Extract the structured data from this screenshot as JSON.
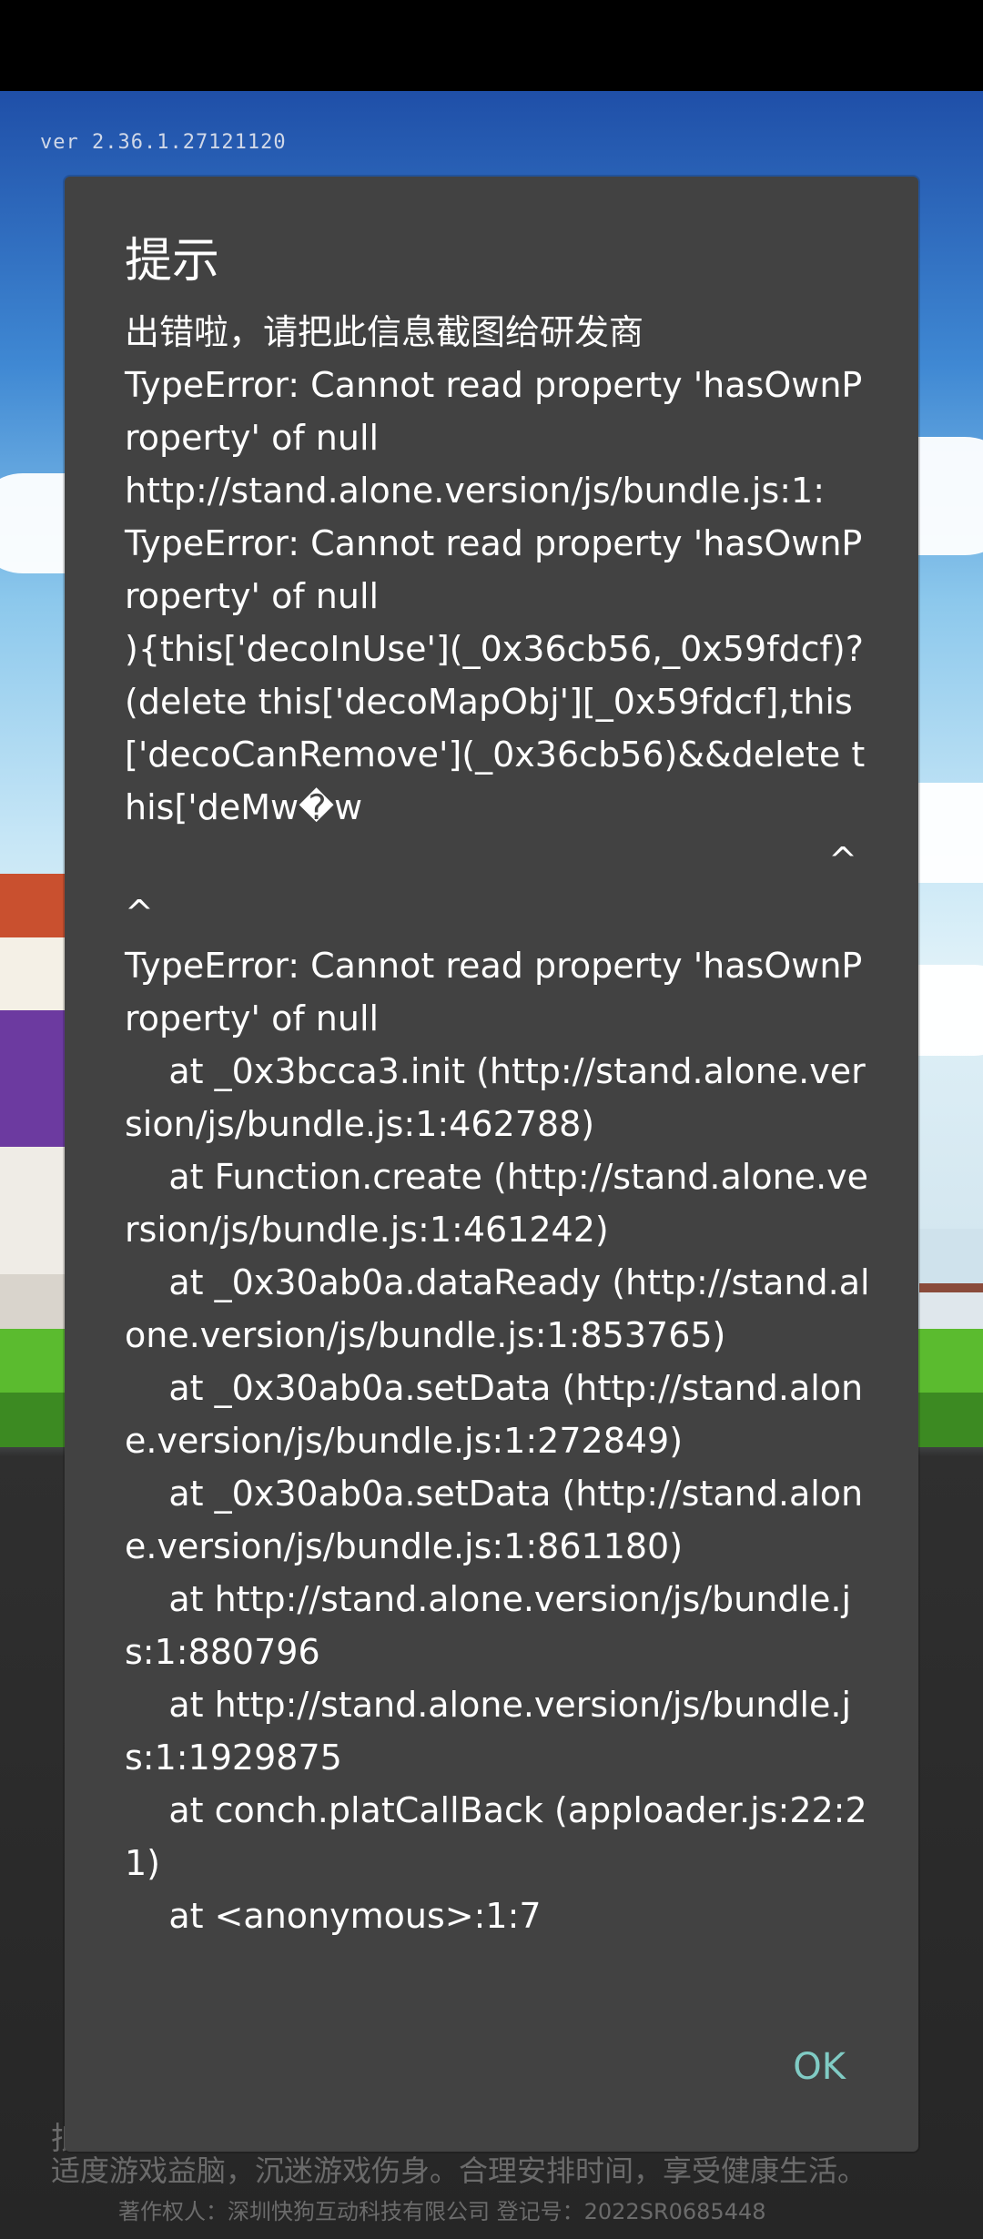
{
  "version": "ver 2.36.1.27121120",
  "dialog": {
    "title": "提示",
    "message": "出错啦，请把此信息截图给研发商\nTypeError: Cannot read property 'hasOwnProperty' of null\nhttp://stand.alone.version/js/bundle.js:1:\nTypeError: Cannot read property 'hasOwnProperty' of null\n){this['decoInUse'](_0x36cb56,_0x59fdcf)?(delete this['decoMapObj'][_0x59fdcf],this['decoCanRemove'](_0x36cb56)&&delete this['deMw�w\n                                                                ^^\nTypeError: Cannot read property 'hasOwnProperty' of null\n    at _0x3bcca3.init (http://stand.alone.version/js/bundle.js:1:462788)\n    at Function.create (http://stand.alone.version/js/bundle.js:1:461242)\n    at _0x30ab0a.dataReady (http://stand.alone.version/js/bundle.js:1:853765)\n    at _0x30ab0a.setData (http://stand.alone.version/js/bundle.js:1:272849)\n    at _0x30ab0a.setData (http://stand.alone.version/js/bundle.js:1:861180)\n    at http://stand.alone.version/js/bundle.js:1:880796\n    at http://stand.alone.version/js/bundle.js:1:1929875\n    at conch.platCallBack (apploader.js:22:21)\n    at <anonymous>:1:7",
    "ok_label": "OK"
  },
  "footer": {
    "partial_line": "抵",
    "health_notice": "适度游戏益脑，沉迷游戏伤身。合理安排时间，享受健康生活。",
    "copyright": "著作权人：深圳快狗互动科技有限公司    登记号：2022SR0685448"
  }
}
